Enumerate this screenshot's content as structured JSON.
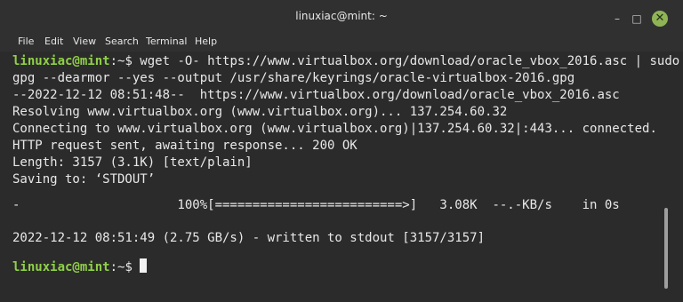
{
  "window": {
    "title": "linuxiac@mint: ~"
  },
  "controls": {
    "minimize": "–",
    "maximize": "□",
    "close": "✕"
  },
  "menu": [
    "File",
    "Edit",
    "View",
    "Search",
    "Terminal",
    "Help"
  ],
  "prompt": {
    "user_host": "linuxiac@mint",
    "path": ":~",
    "symbol": "$"
  },
  "terminal": {
    "command_line1": " wget -O- https://www.virtualbox.org/download/oracle_vbox_2016.asc | sudo",
    "command_line2": "gpg --dearmor --yes --output /usr/share/keyrings/oracle-virtualbox-2016.gpg",
    "out1": "--2022-12-12 08:51:48--  https://www.virtualbox.org/download/oracle_vbox_2016.asc",
    "out2": "Resolving www.virtualbox.org (www.virtualbox.org)... 137.254.60.32",
    "out3": "Connecting to www.virtualbox.org (www.virtualbox.org)|137.254.60.32|:443... connected.",
    "out4": "HTTP request sent, awaiting response... 200 OK",
    "out5": "Length: 3157 (3.1K) [text/plain]",
    "out6": "Saving to: ‘STDOUT’",
    "progress": "-                     100%[=========================>]   3.08K  --.-KB/s    in 0s",
    "out7": "2022-12-12 08:51:49 (2.75 GB/s) - written to stdout [3157/3157]"
  },
  "colors": {
    "prompt": "#8fd047",
    "background": "#2b2b2b",
    "close_button": "#8fb456"
  }
}
